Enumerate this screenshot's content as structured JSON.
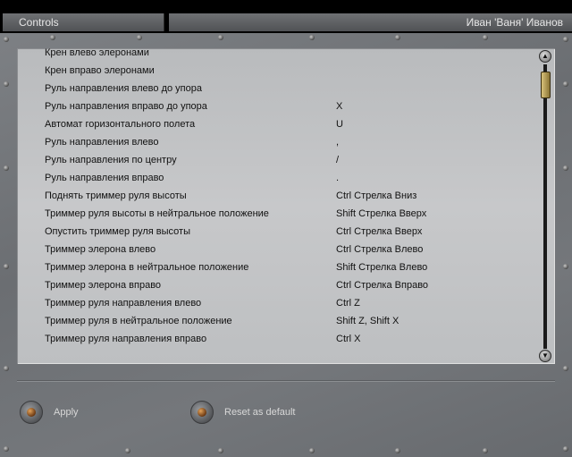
{
  "window": {
    "title": "Controls",
    "user": "Иван 'Ваня' Иванов"
  },
  "bindings": [
    {
      "action": "Крен влево элеронами",
      "key": ""
    },
    {
      "action": "Крен вправо элеронами",
      "key": ""
    },
    {
      "action": "Руль направления влево до упора",
      "key": ""
    },
    {
      "action": "Руль направления вправо до упора",
      "key": "X"
    },
    {
      "action": "Автомат горизонтального полета",
      "key": "U"
    },
    {
      "action": "Руль направления влево",
      "key": ","
    },
    {
      "action": "Руль направления по центру",
      "key": "/"
    },
    {
      "action": "Руль направления вправо",
      "key": "."
    },
    {
      "action": "Поднять триммер руля высоты",
      "key": "Ctrl Стрелка Вниз"
    },
    {
      "action": "Триммер руля высоты в нейтральное положение",
      "key": "Shift Стрелка Вверх"
    },
    {
      "action": "Опустить триммер руля высоты",
      "key": "Ctrl Стрелка Вверх"
    },
    {
      "action": "Триммер элерона влево",
      "key": "Ctrl Стрелка Влево"
    },
    {
      "action": "Триммер элерона в нейтральное положение",
      "key": "Shift Стрелка Влево"
    },
    {
      "action": "Триммер элерона вправо",
      "key": "Ctrl Стрелка Вправо"
    },
    {
      "action": "Триммер руля направления влево",
      "key": "Ctrl Z"
    },
    {
      "action": "Триммер руля в нейтральное положение",
      "key": "Shift Z, Shift X"
    },
    {
      "action": "Триммер руля направления вправо",
      "key": "Ctrl X"
    }
  ],
  "footer": {
    "apply_label": "Apply",
    "reset_label": "Reset as default"
  },
  "icons": {
    "scroll_up": "scroll-up-arrow-icon",
    "scroll_down": "scroll-down-arrow-icon",
    "apply_knob": "knob-icon",
    "reset_knob": "knob-icon"
  }
}
